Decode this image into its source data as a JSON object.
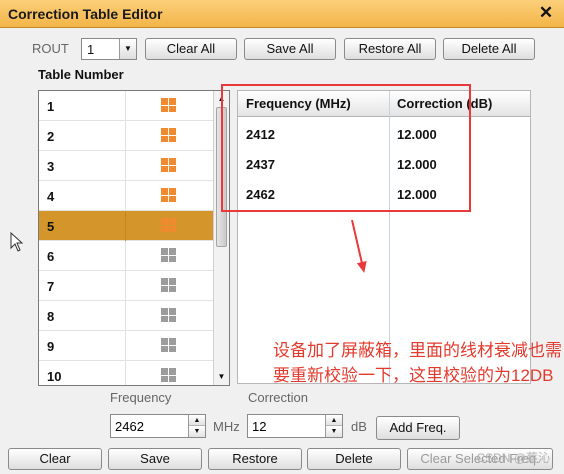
{
  "window": {
    "title": "Correction Table Editor",
    "close_glyph": "✕"
  },
  "toolbar": {
    "rout_label": "ROUT",
    "rout_value": "1",
    "clear_all": "Clear All",
    "save_all": "Save All",
    "restore_all": "Restore All",
    "delete_all": "Delete All"
  },
  "table_number_label": "Table Number",
  "tables": [
    {
      "number": "1",
      "icon": "table-icon-orange"
    },
    {
      "number": "2",
      "icon": "table-icon-orange"
    },
    {
      "number": "3",
      "icon": "table-icon-orange"
    },
    {
      "number": "4",
      "icon": "table-icon-orange"
    },
    {
      "number": "5",
      "icon": "table-icon-orange",
      "selected": true
    },
    {
      "number": "6",
      "icon": "table-icon-gray"
    },
    {
      "number": "7",
      "icon": "table-icon-gray"
    },
    {
      "number": "8",
      "icon": "table-icon-gray"
    },
    {
      "number": "9",
      "icon": "table-icon-gray"
    },
    {
      "number": "10",
      "icon": "table-icon-gray"
    }
  ],
  "freq_table": {
    "headers": [
      "Frequency (MHz)",
      "Correction (dB)"
    ],
    "rows": [
      [
        "2412",
        "12.000"
      ],
      [
        "2437",
        "12.000"
      ],
      [
        "2462",
        "12.000"
      ]
    ]
  },
  "inputs": {
    "frequency_label": "Frequency",
    "frequency_value": "2462",
    "frequency_unit": "MHz",
    "correction_label": "Correction",
    "correction_value": "12",
    "correction_unit": "dB",
    "add_freq": "Add Freq."
  },
  "bottom_buttons": {
    "clear": "Clear",
    "save": "Save",
    "restore": "Restore",
    "delete": "Delete",
    "clear_selected": "Clear Selected Freq."
  },
  "annotation": "设备加了屏蔽箱，里面的线材衰减也需要重新校验一下，这里校验的为12DB",
  "watermark": "CSDN @蔡沁",
  "colors": {
    "title_bar": "#f3b548",
    "selected_row": "#d4962a",
    "annotation": "#e83a3a"
  }
}
